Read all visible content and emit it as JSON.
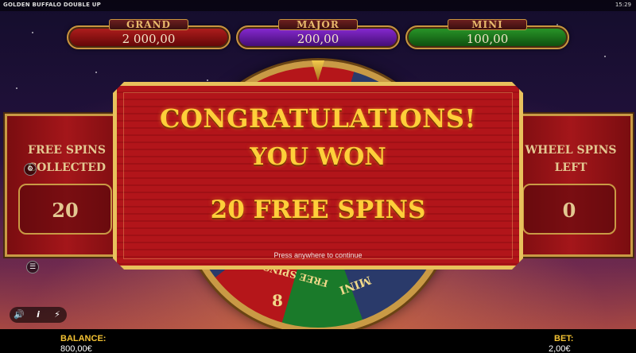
{
  "top_bar": {
    "game_title": "GOLDEN BUFFALO DOUBLE UP",
    "clock": "15:29"
  },
  "jackpots": [
    {
      "name": "GRAND",
      "value": "2 000,00",
      "color": "#b31e1e"
    },
    {
      "name": "MAJOR",
      "value": "200,00",
      "color": "#8a2ad6"
    },
    {
      "name": "MINI",
      "value": "100,00",
      "color": "#2a9a2a"
    }
  ],
  "left_panel": {
    "label_line1": "FREE SPINS",
    "label_line2": "COLLECTED",
    "value": "20"
  },
  "right_panel": {
    "label_line1": "WHEEL SPINS",
    "label_line2": "LEFT",
    "value": "0"
  },
  "popup": {
    "line1": "CONGRATULATIONS!",
    "line2": "YOU WON",
    "line3": "20 FREE SPINS",
    "hint": "Press anywhere to continue"
  },
  "wheel": {
    "segment_text_a": "FREE SPINS",
    "segment_number": "8",
    "segment_text_b": "MINI"
  },
  "controls": {
    "sound_icon": "speaker-icon",
    "info_icon": "info-icon",
    "turbo_icon": "lightning-icon"
  },
  "bottom_bar": {
    "balance_label": "BALANCE:",
    "balance_value": "800,00€",
    "bet_label": "BET:",
    "bet_value": "2,00€"
  },
  "colors": {
    "accent_gold": "#ffcf3a",
    "panel_red": "#a4161a",
    "frame_gold": "#c99a45"
  }
}
